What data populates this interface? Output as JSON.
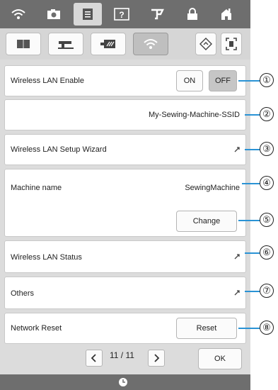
{
  "top_tabs": [
    {
      "icon": "wifi-icon"
    },
    {
      "icon": "camera-icon"
    },
    {
      "icon": "document-icon"
    },
    {
      "icon": "help-icon"
    },
    {
      "icon": "thread-icon"
    },
    {
      "icon": "lock-icon"
    },
    {
      "icon": "home-icon"
    }
  ],
  "sub_tabs": [
    {
      "icon": "book-icon"
    },
    {
      "icon": "sewing-machine-icon"
    },
    {
      "icon": "embroidery-frame-icon"
    },
    {
      "icon": "wifi-icon"
    }
  ],
  "wireless_lan_enable": {
    "label": "Wireless LAN Enable",
    "on_label": "ON",
    "off_label": "OFF"
  },
  "ssid": {
    "value": "My-Sewing-Machine-SSID"
  },
  "setup_wizard": {
    "label": "Wireless LAN Setup Wizard"
  },
  "machine_name": {
    "label": "Machine name",
    "value": "SewingMachine",
    "change_label": "Change"
  },
  "status": {
    "label": "Wireless LAN Status"
  },
  "others": {
    "label": "Others"
  },
  "network_reset": {
    "label": "Network Reset",
    "reset_label": "Reset"
  },
  "pager": {
    "text": "11 / 11",
    "ok_label": "OK"
  },
  "callouts": [
    "①",
    "②",
    "③",
    "④",
    "⑤",
    "⑥",
    "⑦",
    "⑧"
  ],
  "colors": {
    "accent": "#2a93d5",
    "topbar": "#6e6e6e"
  }
}
